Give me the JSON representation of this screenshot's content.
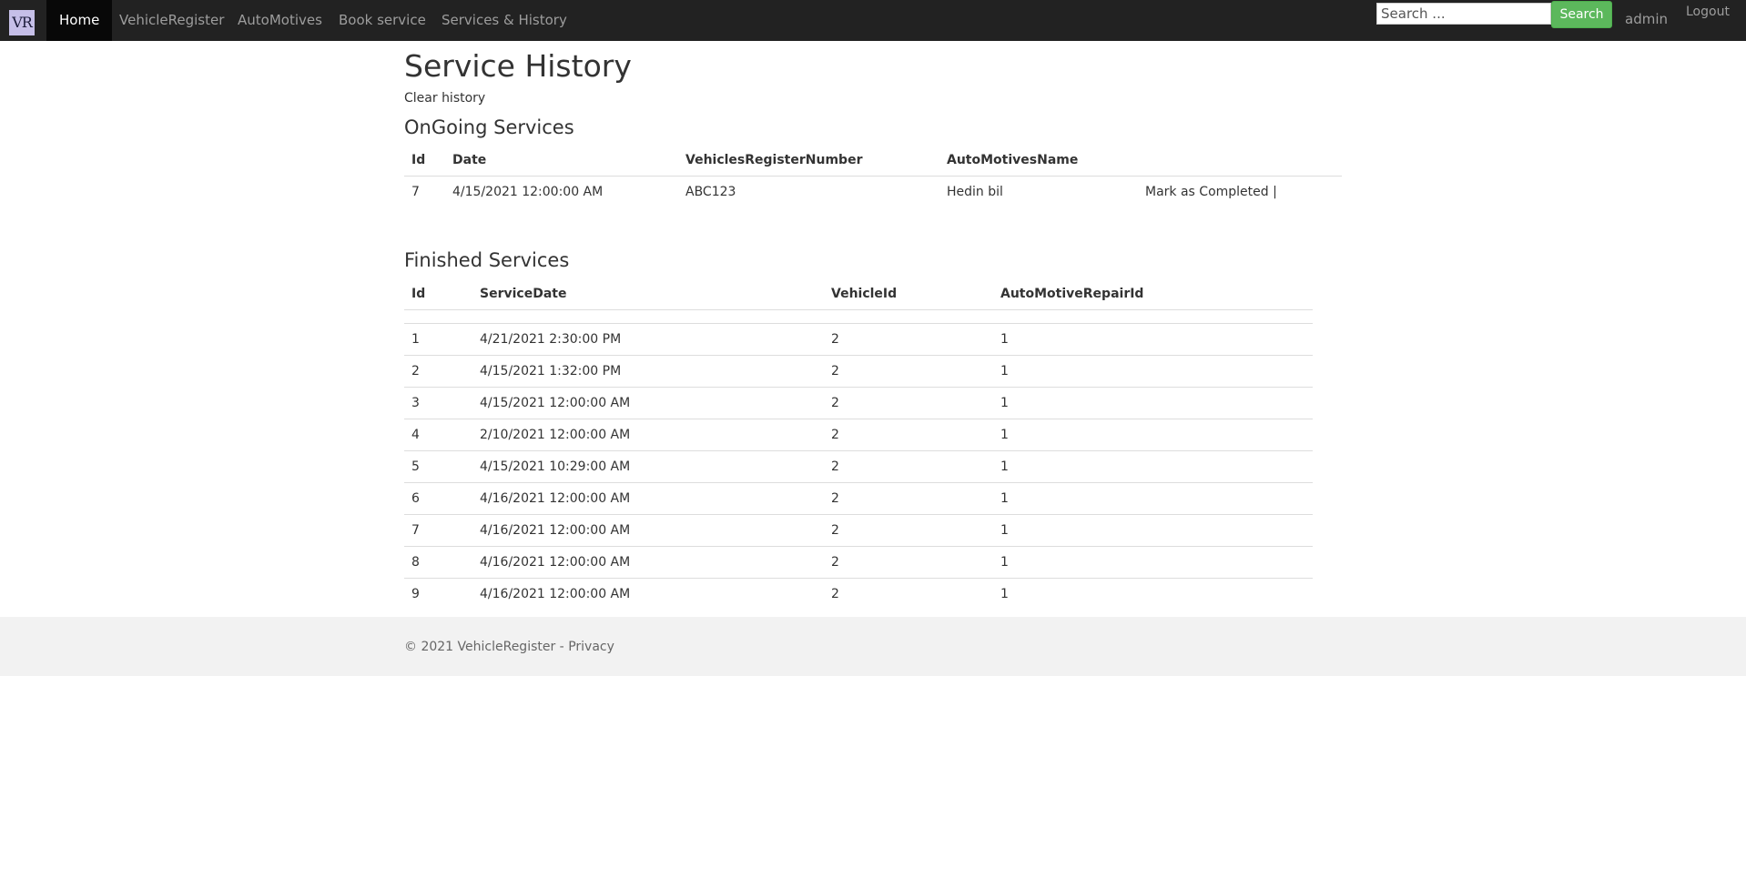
{
  "nav": {
    "logo_text": "VR",
    "items": [
      {
        "label": "Home",
        "active": true
      },
      {
        "label": "VehicleRegister"
      },
      {
        "label": "AutoMotives"
      },
      {
        "label": "Book service"
      },
      {
        "label": "Services & History"
      }
    ],
    "search_placeholder": "Search ...",
    "search_button": "Search",
    "user": "admin",
    "logout": "Logout"
  },
  "page": {
    "title": "Service History",
    "clear_history": "Clear history"
  },
  "ongoing": {
    "heading": "OnGoing Services",
    "columns": [
      "Id",
      "Date",
      "VehiclesRegisterNumber",
      "AutoMotivesName"
    ],
    "rows": [
      {
        "id": "7",
        "date": "4/15/2021 12:00:00 AM",
        "reg": "ABC123",
        "auto": "Hedin bil",
        "action": "Mark as Completed |"
      }
    ]
  },
  "finished": {
    "heading": "Finished Services",
    "columns": [
      "Id",
      "ServiceDate",
      "VehicleId",
      "AutoMotiveRepairId"
    ],
    "rows": [
      {
        "id": "1",
        "date": "4/21/2021 2:30:00 PM",
        "vehicle": "2",
        "repair": "1"
      },
      {
        "id": "2",
        "date": "4/15/2021 1:32:00 PM",
        "vehicle": "2",
        "repair": "1"
      },
      {
        "id": "3",
        "date": "4/15/2021 12:00:00 AM",
        "vehicle": "2",
        "repair": "1"
      },
      {
        "id": "4",
        "date": "2/10/2021 12:00:00 AM",
        "vehicle": "2",
        "repair": "1"
      },
      {
        "id": "5",
        "date": "4/15/2021 10:29:00 AM",
        "vehicle": "2",
        "repair": "1"
      },
      {
        "id": "6",
        "date": "4/16/2021 12:00:00 AM",
        "vehicle": "2",
        "repair": "1"
      },
      {
        "id": "7",
        "date": "4/16/2021 12:00:00 AM",
        "vehicle": "2",
        "repair": "1"
      },
      {
        "id": "8",
        "date": "4/16/2021 12:00:00 AM",
        "vehicle": "2",
        "repair": "1"
      },
      {
        "id": "9",
        "date": "4/16/2021 12:00:00 AM",
        "vehicle": "2",
        "repair": "1"
      }
    ]
  },
  "footer": {
    "copyright": "© 2021 VehicleRegister - ",
    "privacy": "Privacy"
  },
  "colors": {
    "navbar": "#222222",
    "active_nav": "#080808",
    "search_button": "#5cb85c",
    "footer": "#f2f2f2"
  }
}
